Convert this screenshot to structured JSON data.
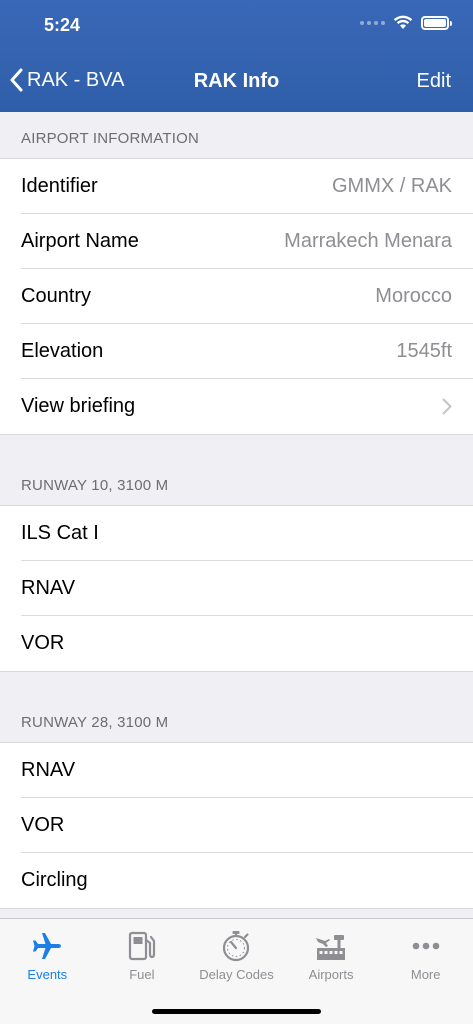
{
  "status": {
    "time": "5:24"
  },
  "nav": {
    "back_label": "RAK - BVA",
    "title": "RAK Info",
    "edit_label": "Edit"
  },
  "sections": [
    {
      "header": "AIRPORT INFORMATION",
      "rows": [
        {
          "label": "Identifier",
          "value": "GMMX / RAK"
        },
        {
          "label": "Airport Name",
          "value": "Marrakech Menara"
        },
        {
          "label": "Country",
          "value": "Morocco"
        },
        {
          "label": "Elevation",
          "value": "1545ft"
        },
        {
          "label": "View briefing"
        }
      ]
    },
    {
      "header": "RUNWAY 10, 3100 M",
      "rows": [
        {
          "label": "ILS Cat I"
        },
        {
          "label": "RNAV"
        },
        {
          "label": "VOR"
        }
      ]
    },
    {
      "header": "RUNWAY 28, 3100 M",
      "rows": [
        {
          "label": "RNAV"
        },
        {
          "label": "VOR"
        },
        {
          "label": "Circling"
        }
      ]
    }
  ],
  "tabs": [
    {
      "label": "Events",
      "icon": "airplane-icon",
      "active": true
    },
    {
      "label": "Fuel",
      "icon": "fuel-pump-icon"
    },
    {
      "label": "Delay Codes",
      "icon": "stopwatch-icon"
    },
    {
      "label": "Airports",
      "icon": "airport-icon"
    },
    {
      "label": "More",
      "icon": "more-dots-icon"
    }
  ],
  "colors": {
    "header": "#3366b3",
    "accent": "#1a7fe6",
    "inactive": "#8e8e93"
  }
}
